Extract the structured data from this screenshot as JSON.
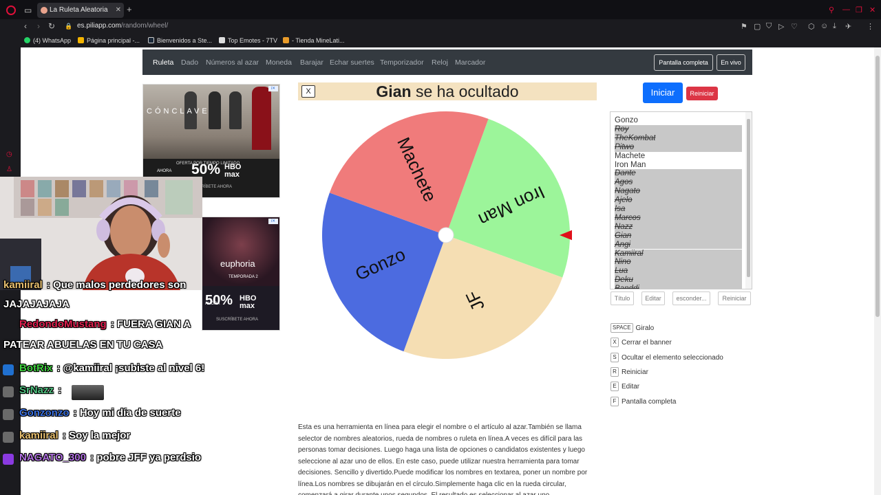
{
  "browser": {
    "tab_title": "La Ruleta Aleatoria",
    "url_host": "es.piliapp.com",
    "url_path": "/random/wheel/",
    "bookmarks": [
      "(4) WhatsApp",
      "Página principal -...",
      "Bienvenidos a Ste...",
      "Top Emotes - 7TV",
      "- Tienda MineLati..."
    ]
  },
  "site": {
    "nav": [
      "Ruleta",
      "Dado",
      "Números al azar",
      "Moneda",
      "Barajar",
      "Echar suertes",
      "Temporizador",
      "Reloj",
      "Marcador"
    ],
    "fullscreen_label": "Pantalla completa",
    "live_label": "En vivo",
    "ad1": {
      "title": "CÓNCLAVE",
      "offer": "OFERTA POR TIEMPO LIMITADO",
      "ahora": "AHORA",
      "discount": "50%",
      "brand": "HBO max",
      "cta": "SUSCRÍBETE AHORA"
    },
    "ad2": {
      "title": "euphoria",
      "subtitle": "TEMPORADA 2",
      "ahora": "AHORA",
      "discount": "50%",
      "brand": "HBO max",
      "cta": "SUSCRÍBETE AHORA"
    }
  },
  "banner": {
    "close_label": "X",
    "name": "Gian",
    "message": "se ha ocultado"
  },
  "wheel": {
    "segments": [
      {
        "label": "Iron Man",
        "color": "#9cf59a"
      },
      {
        "label": "JF",
        "color": "#f5deb3"
      },
      {
        "label": "Gonzo",
        "color": "#4c6be0"
      },
      {
        "label": "Machete",
        "color": "#f07b7b"
      }
    ],
    "pointer_color": "#e0101a"
  },
  "controls": {
    "start_label": "Iniciar",
    "reset_label": "Reiniciar",
    "title_btn": "Título",
    "edit_btn": "Editar",
    "hide_btn": "esconder...",
    "reset_btn": "Reiniciar"
  },
  "names": [
    {
      "name": "Gonzo",
      "hidden": false
    },
    {
      "name": "Roy",
      "hidden": true
    },
    {
      "name": "TheKombat",
      "hidden": true
    },
    {
      "name": "Pitwo",
      "hidden": true
    },
    {
      "name": "Machete",
      "hidden": false
    },
    {
      "name": "Iron Man",
      "hidden": false
    },
    {
      "name": "Dante",
      "hidden": true
    },
    {
      "name": "Agos",
      "hidden": true
    },
    {
      "name": "Nagato",
      "hidden": true
    },
    {
      "name": "Ajelo",
      "hidden": true
    },
    {
      "name": "Isa",
      "hidden": true
    },
    {
      "name": "Marcos",
      "hidden": true
    },
    {
      "name": "Nazz",
      "hidden": true
    },
    {
      "name": "Gian",
      "hidden": true
    },
    {
      "name": "Angi",
      "hidden": true
    },
    {
      "name": "Kamiiral",
      "hidden": true
    },
    {
      "name": "Nino",
      "hidden": true
    },
    {
      "name": "Lua",
      "hidden": true
    },
    {
      "name": "Deku",
      "hidden": true
    },
    {
      "name": "Banddi",
      "hidden": true
    }
  ],
  "shortcuts": [
    {
      "key": "SPACE",
      "label": "Giralo"
    },
    {
      "key": "X",
      "label": "Cerrar el banner"
    },
    {
      "key": "S",
      "label": "Ocultar el elemento seleccionado"
    },
    {
      "key": "R",
      "label": "Reiniciar"
    },
    {
      "key": "E",
      "label": "Editar"
    },
    {
      "key": "F",
      "label": "Pantalla completa"
    }
  ],
  "description": "Esta es una herramienta en línea para elegir el nombre o el artículo al azar.También se llama selector de nombres aleatorios, rueda de nombres o ruleta en línea.A veces es difícil para las personas tomar decisiones. Luego haga una lista de opciones o candidatos existentes y luego seleccione al azar uno de ellos. En este caso, puede utilizar nuestra herramienta para tomar decisiones. Sencillo y divertido.Puede modificar los nombres en textarea, poner un nombre por línea.Los nombres se dibujarán en el círculo.Simplemente haga clic en la rueda circular, comenzará a girar durante unos segundos. El resultado es seleccionar al azar uno",
  "chat": [
    {
      "user": "kamiiral",
      "user_color": "#e8c070",
      "message": "Que malos perdedores son JAJAJAJAJA"
    },
    {
      "user": "RedondoMustang",
      "user_color": "#e02050",
      "message": "FUERA GIAN A PATEAR ABUELAS EN TU CASA"
    },
    {
      "user": "BotRix",
      "user_color": "#40d040",
      "message": "@kamiiral ¡subiste al nivel 6!"
    },
    {
      "user": "SrNazz",
      "user_color": "#50c080",
      "message": ""
    },
    {
      "user": "Gonzonzo",
      "user_color": "#3a70e0",
      "message": "Hoy mi día de suerte"
    },
    {
      "user": "kamiiral",
      "user_color": "#e8c070",
      "message": "Soy la mejor"
    },
    {
      "user": "NAGATO_300",
      "user_color": "#b070e0",
      "message": "pobre JFF ya perdsio"
    }
  ]
}
